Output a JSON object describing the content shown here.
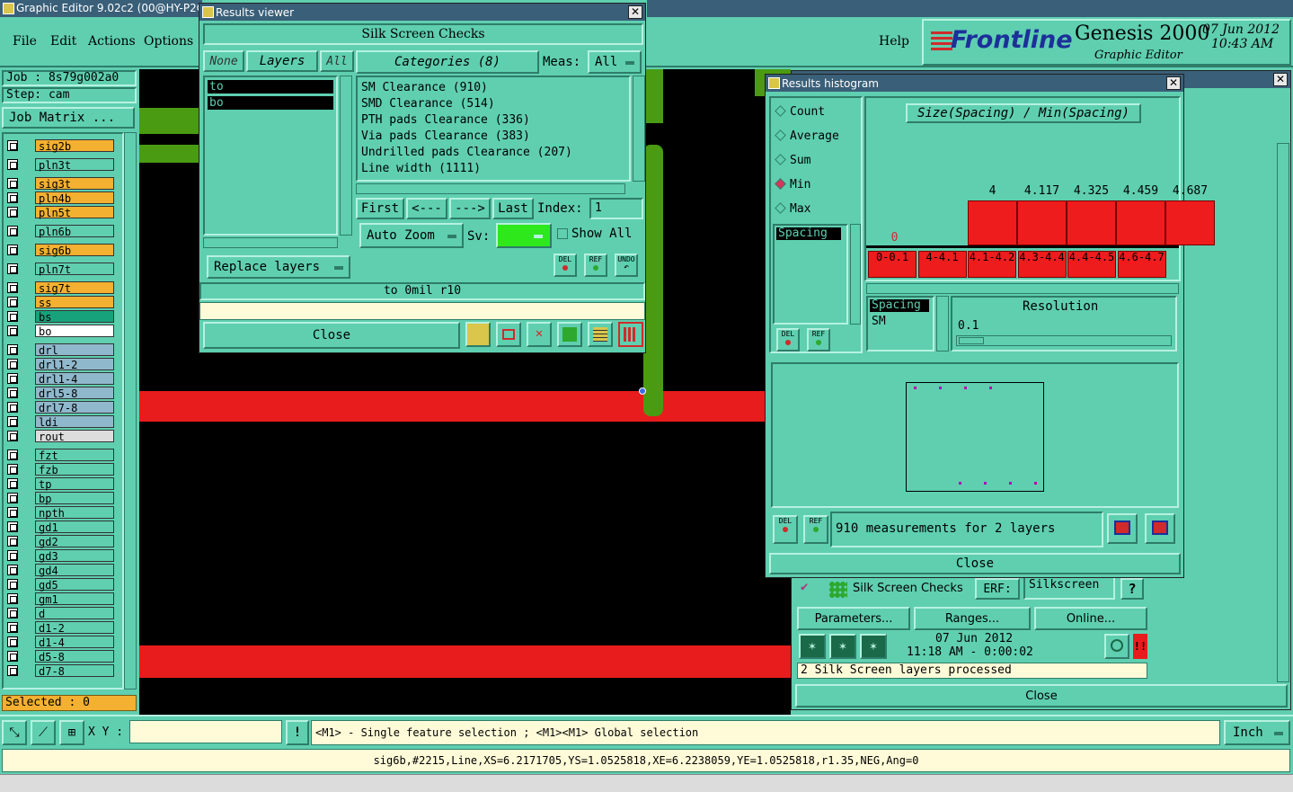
{
  "app": {
    "title": "Graphic Editor 9.02c2 (00@HY-P2QA"
  },
  "menu": {
    "file": "File",
    "edit": "Edit",
    "actions": "Actions",
    "options": "Options",
    "help": "Help"
  },
  "branding": {
    "logo": "Frontline",
    "product": "Genesis 2000",
    "subtitle": "Graphic Editor",
    "date": "07 Jun 2012",
    "time": "10:43 AM"
  },
  "job": {
    "job": "Job : 8s79g002a0",
    "step": "Step: cam",
    "matrix": "Job Matrix ..."
  },
  "layers": [
    {
      "name": "sig2b",
      "color": "#f4b030",
      "flag": "⁄"
    },
    {
      "name": "pln3t",
      "color": "#5fcfb0",
      "flag": ""
    },
    {
      "name": "sig3t",
      "color": "#f4b030",
      "flag": "⁄"
    },
    {
      "name": "pln4b",
      "color": "#f4b030",
      "flag": ""
    },
    {
      "name": "pln5t",
      "color": "#f4b030",
      "flag": ""
    },
    {
      "name": "pln6b",
      "color": "#5fcfb0",
      "flag": ""
    },
    {
      "name": "sig6b",
      "color": "#f4b030",
      "flag": "⁄"
    },
    {
      "name": "pln7t",
      "color": "#5fcfb0",
      "flag": ""
    },
    {
      "name": "sig7t",
      "color": "#f4b030",
      "flag": "⁄"
    },
    {
      "name": "ss",
      "color": "#f4b030",
      "flag": "⁄"
    },
    {
      "name": "bs",
      "color": "#18a27c",
      "flag": ""
    },
    {
      "name": "bo",
      "color": "#ffffff",
      "flag": ""
    },
    {
      "name": "drl",
      "color": "#8fb8cc",
      "flag": ""
    },
    {
      "name": "drl1-2",
      "color": "#8fb8cc",
      "flag": ""
    },
    {
      "name": "drl1-4",
      "color": "#8fb8cc",
      "flag": ""
    },
    {
      "name": "drl5-8",
      "color": "#8fb8cc",
      "flag": ""
    },
    {
      "name": "drl7-8",
      "color": "#8fb8cc",
      "flag": ""
    },
    {
      "name": "ldi",
      "color": "#8fb8cc",
      "flag": ""
    },
    {
      "name": "rout",
      "color": "#dddddd",
      "flag": ""
    },
    {
      "name": "fzt",
      "color": "#5fcfb0",
      "flag": ""
    },
    {
      "name": "fzb",
      "color": "#5fcfb0",
      "flag": ""
    },
    {
      "name": "tp",
      "color": "#5fcfb0",
      "flag": ""
    },
    {
      "name": "bp",
      "color": "#5fcfb0",
      "flag": ""
    },
    {
      "name": "npth",
      "color": "#5fcfb0",
      "flag": ""
    },
    {
      "name": "gd1",
      "color": "#5fcfb0",
      "flag": "⁄"
    },
    {
      "name": "gd2",
      "color": "#5fcfb0",
      "flag": "⁄"
    },
    {
      "name": "gd3",
      "color": "#5fcfb0",
      "flag": ""
    },
    {
      "name": "gd4",
      "color": "#5fcfb0",
      "flag": "⁄"
    },
    {
      "name": "gd5",
      "color": "#5fcfb0",
      "flag": ""
    },
    {
      "name": "gm1",
      "color": "#5fcfb0",
      "flag": ""
    },
    {
      "name": "d",
      "color": "#5fcfb0",
      "flag": ""
    },
    {
      "name": "d1-2",
      "color": "#5fcfb0",
      "flag": ""
    },
    {
      "name": "d1-4",
      "color": "#5fcfb0",
      "flag": ""
    },
    {
      "name": "d5-8",
      "color": "#5fcfb0",
      "flag": ""
    },
    {
      "name": "d7-8",
      "color": "#5fcfb0",
      "flag": ""
    }
  ],
  "selected": "Selected : 0",
  "results_viewer": {
    "title": "Results viewer",
    "header": "Silk Screen Checks",
    "none": "None",
    "layers_tab": "Layers",
    "all": "All",
    "layer_items": [
      "to",
      "bo"
    ],
    "categories": "Categories (8)",
    "meas_label": "Meas:",
    "meas_value": "All",
    "category_items": [
      "SM Clearance (910)",
      "SMD Clearance (514)",
      "PTH pads Clearance (336)",
      "Via pads Clearance (383)",
      "Undrilled pads Clearance (207)",
      "Line width (1111)"
    ],
    "first": "First",
    "prev": "<---",
    "next": "--->",
    "last": "Last",
    "index_label": "Index:",
    "index_value": "1",
    "auto_zoom": "Auto Zoom",
    "sv_label": "Sv:",
    "show_all": "Show All",
    "replace_layers": "Replace layers",
    "status": "to 0mil r10",
    "close": "Close",
    "del": "DEL",
    "ref": "REF",
    "undo": "UNDO"
  },
  "histogram": {
    "title": "Results histogram",
    "radios": [
      "Count",
      "Average",
      "Sum",
      "Min",
      "Max"
    ],
    "heading": "Size(Spacing) / Min(Spacing)",
    "bar_values": [
      "0",
      "4",
      "4.117",
      "4.325",
      "4.459",
      "4.687"
    ],
    "bar_ranges": [
      "0-0.1",
      "4-4.1",
      "4.1-4.2",
      "4.3-4.4",
      "4.4-4.5",
      "4.6-4.7"
    ],
    "list_item": "Spacing",
    "list2": [
      "Spacing",
      "SM"
    ],
    "resolution_label": "Resolution",
    "resolution_value": "0.1",
    "summary": "910 measurements for 2 layers",
    "close": "Close",
    "del": "DEL",
    "ref": "REF"
  },
  "checklist": {
    "check_name": "Silk Screen Checks",
    "erf_label": "ERF:",
    "erf_value": "Silkscreen",
    "parameters": "Parameters...",
    "ranges": "Ranges...",
    "online": "Online...",
    "date": "07 Jun 2012",
    "time": "11:18 AM - 0:00:02",
    "status": "2 Silk Screen layers processed",
    "close": "Close"
  },
  "bottom": {
    "xy_label": "X Y :",
    "hint": "<M1> - Single feature selection ; <M1><M1> Global selection",
    "units": "Inch",
    "feature": "sig6b,#2215,Line,XS=6.2171705,YS=1.0525818,XE=6.2238059,YE=1.0525818,r1.35,NEG,Ang=0"
  }
}
